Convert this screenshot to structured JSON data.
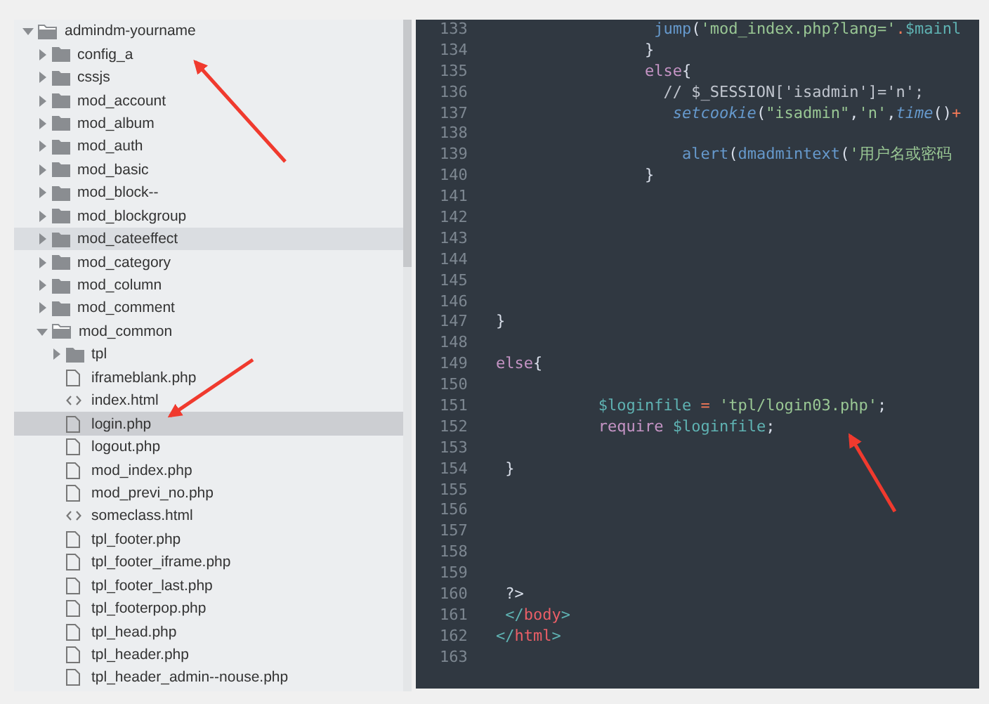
{
  "sidebar": {
    "tree": [
      {
        "name": "admindm-yourname",
        "kind": "folder",
        "expanded": true,
        "selected": false,
        "hovered": false,
        "children": [
          {
            "name": "config_a",
            "kind": "folder",
            "expanded": false,
            "selected": false,
            "hovered": false
          },
          {
            "name": "cssjs",
            "kind": "folder",
            "expanded": false,
            "selected": false,
            "hovered": false
          },
          {
            "name": "mod_account",
            "kind": "folder",
            "expanded": false,
            "selected": false,
            "hovered": false
          },
          {
            "name": "mod_album",
            "kind": "folder",
            "expanded": false,
            "selected": false,
            "hovered": false
          },
          {
            "name": "mod_auth",
            "kind": "folder",
            "expanded": false,
            "selected": false,
            "hovered": false
          },
          {
            "name": "mod_basic",
            "kind": "folder",
            "expanded": false,
            "selected": false,
            "hovered": false
          },
          {
            "name": "mod_block--",
            "kind": "folder",
            "expanded": false,
            "selected": false,
            "hovered": false
          },
          {
            "name": "mod_blockgroup",
            "kind": "folder",
            "expanded": false,
            "selected": false,
            "hovered": false
          },
          {
            "name": "mod_cateeffect",
            "kind": "folder",
            "expanded": false,
            "selected": false,
            "hovered": true
          },
          {
            "name": "mod_category",
            "kind": "folder",
            "expanded": false,
            "selected": false,
            "hovered": false
          },
          {
            "name": "mod_column",
            "kind": "folder",
            "expanded": false,
            "selected": false,
            "hovered": false
          },
          {
            "name": "mod_comment",
            "kind": "folder",
            "expanded": false,
            "selected": false,
            "hovered": false
          },
          {
            "name": "mod_common",
            "kind": "folder",
            "expanded": true,
            "selected": false,
            "hovered": false,
            "children": [
              {
                "name": "tpl",
                "kind": "folder",
                "expanded": false,
                "selected": false,
                "hovered": false
              },
              {
                "name": "iframeblank.php",
                "kind": "file",
                "selected": false,
                "hovered": false
              },
              {
                "name": "index.html",
                "kind": "markup",
                "selected": false,
                "hovered": false
              },
              {
                "name": "login.php",
                "kind": "file",
                "selected": true,
                "hovered": false
              },
              {
                "name": "logout.php",
                "kind": "file",
                "selected": false,
                "hovered": false
              },
              {
                "name": "mod_index.php",
                "kind": "file",
                "selected": false,
                "hovered": false
              },
              {
                "name": "mod_previ_no.php",
                "kind": "file",
                "selected": false,
                "hovered": false
              },
              {
                "name": "someclass.html",
                "kind": "markup",
                "selected": false,
                "hovered": false
              },
              {
                "name": "tpl_footer.php",
                "kind": "file",
                "selected": false,
                "hovered": false
              },
              {
                "name": "tpl_footer_iframe.php",
                "kind": "file",
                "selected": false,
                "hovered": false
              },
              {
                "name": "tpl_footer_last.php",
                "kind": "file",
                "selected": false,
                "hovered": false
              },
              {
                "name": "tpl_footerpop.php",
                "kind": "file",
                "selected": false,
                "hovered": false
              },
              {
                "name": "tpl_head.php",
                "kind": "file",
                "selected": false,
                "hovered": false
              },
              {
                "name": "tpl_header.php",
                "kind": "file",
                "selected": false,
                "hovered": false
              },
              {
                "name": "tpl_header_admin--nouse.php",
                "kind": "file",
                "selected": false,
                "hovered": false
              }
            ]
          }
        ]
      }
    ]
  },
  "editor": {
    "lines": [
      {
        "number": "133",
        "tokens": [
          {
            "text": "                 jump",
            "kind": "function"
          },
          {
            "text": "(",
            "kind": "plain"
          },
          {
            "text": "'mod_index.php?lang='",
            "kind": "string"
          },
          {
            "text": ".",
            "kind": "operator"
          },
          {
            "text": "$mainl",
            "kind": "variable"
          }
        ]
      },
      {
        "number": "134",
        "tokens": [
          {
            "text": "                }",
            "kind": "plain"
          }
        ]
      },
      {
        "number": "135",
        "tokens": [
          {
            "text": "                else",
            "kind": "keyword"
          },
          {
            "text": "{",
            "kind": "plain"
          }
        ]
      },
      {
        "number": "136",
        "tokens": [
          {
            "text": "                  // $_SESSION['isadmin']='n';",
            "kind": "comment"
          }
        ]
      },
      {
        "number": "137",
        "tokens": [
          {
            "text": "                   setcookie",
            "kind": "italic-function"
          },
          {
            "text": "(",
            "kind": "plain"
          },
          {
            "text": "\"isadmin\"",
            "kind": "string"
          },
          {
            "text": ",",
            "kind": "plain"
          },
          {
            "text": "'n'",
            "kind": "string"
          },
          {
            "text": ",",
            "kind": "plain"
          },
          {
            "text": "time",
            "kind": "italic-function"
          },
          {
            "text": "()",
            "kind": "plain"
          },
          {
            "text": "+",
            "kind": "operator"
          }
        ]
      },
      {
        "number": "138"
      },
      {
        "number": "139",
        "tokens": [
          {
            "text": "                    alert",
            "kind": "function"
          },
          {
            "text": "(",
            "kind": "plain"
          },
          {
            "text": "dmadmintext",
            "kind": "function"
          },
          {
            "text": "(",
            "kind": "plain"
          },
          {
            "text": "'用户名或密码",
            "kind": "string"
          }
        ]
      },
      {
        "number": "140",
        "tokens": [
          {
            "text": "                }",
            "kind": "plain"
          }
        ]
      },
      {
        "number": "141"
      },
      {
        "number": "142"
      },
      {
        "number": "143"
      },
      {
        "number": "144"
      },
      {
        "number": "145"
      },
      {
        "number": "146"
      },
      {
        "number": "147",
        "tokens": [
          {
            "text": "}",
            "kind": "plain"
          }
        ]
      },
      {
        "number": "148"
      },
      {
        "number": "149",
        "tokens": [
          {
            "text": "else",
            "kind": "keyword"
          },
          {
            "text": "{",
            "kind": "plain"
          }
        ]
      },
      {
        "number": "150"
      },
      {
        "number": "151",
        "tokens": [
          {
            "text": "           $loginfile",
            "kind": "variable"
          },
          {
            "text": " = ",
            "kind": "operator"
          },
          {
            "text": "'tpl/login03.php'",
            "kind": "string"
          },
          {
            "text": ";",
            "kind": "plain"
          }
        ]
      },
      {
        "number": "152",
        "tokens": [
          {
            "text": "           require",
            "kind": "keyword"
          },
          {
            "text": " $loginfile",
            "kind": "variable"
          },
          {
            "text": ";",
            "kind": "plain"
          }
        ]
      },
      {
        "number": "153"
      },
      {
        "number": "154",
        "tokens": [
          {
            "text": " }",
            "kind": "plain"
          }
        ]
      },
      {
        "number": "155"
      },
      {
        "number": "156"
      },
      {
        "number": "157"
      },
      {
        "number": "158"
      },
      {
        "number": "159"
      },
      {
        "number": "160",
        "tokens": [
          {
            "text": " ?>",
            "kind": "plain"
          }
        ]
      },
      {
        "number": "161",
        "tokens": [
          {
            "text": " </",
            "kind": "tag-bracket"
          },
          {
            "text": "body",
            "kind": "tag-name"
          },
          {
            "text": ">",
            "kind": "tag-bracket"
          }
        ]
      },
      {
        "number": "162",
        "tokens": [
          {
            "text": "</",
            "kind": "tag-bracket"
          },
          {
            "text": "html",
            "kind": "tag-name"
          },
          {
            "text": ">",
            "kind": "tag-bracket"
          }
        ]
      },
      {
        "number": "163"
      }
    ]
  }
}
